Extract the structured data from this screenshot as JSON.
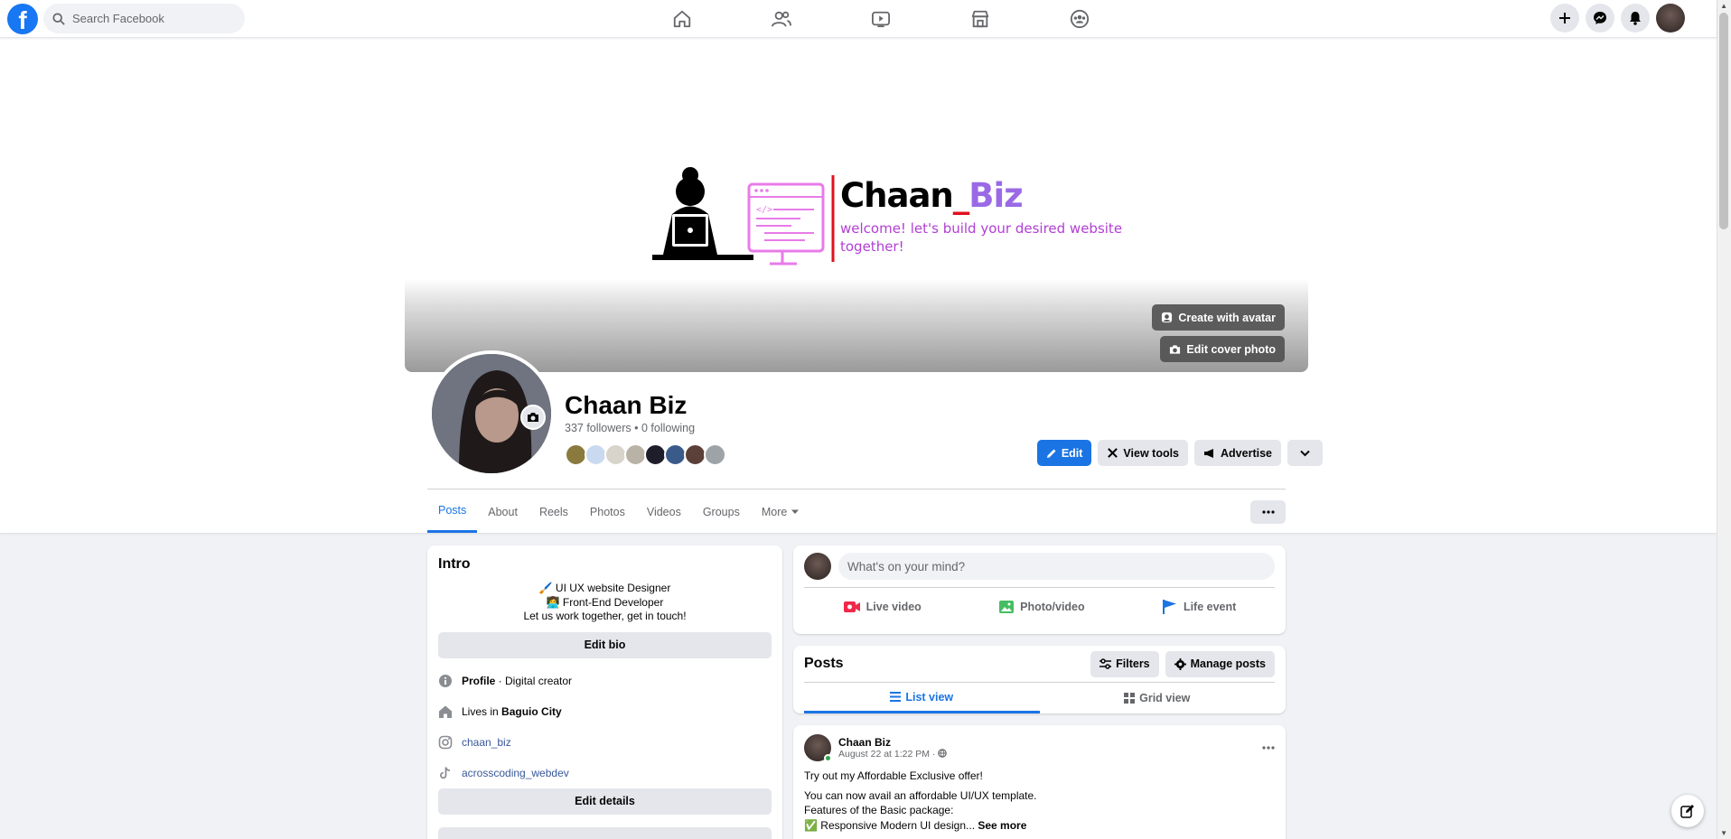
{
  "topbar": {
    "logo": "f",
    "search_placeholder": "Search Facebook",
    "nav": [
      "home-icon",
      "friends-icon",
      "watch-icon",
      "marketplace-icon",
      "groups-icon"
    ]
  },
  "cover": {
    "brand_name": "Chaan",
    "brand_sep": "_",
    "brand_suffix": "Biz",
    "brand_tagline": "welcome! let's build your desired website together!",
    "create_avatar_label": "Create with avatar",
    "edit_cover_label": "Edit cover photo",
    "colors": {
      "brand_black": "#000000",
      "brand_red": "#e0101d",
      "brand_purple": "#9a6ae6",
      "tagline": "#b23fd3"
    }
  },
  "profile": {
    "name": "Chaan Biz",
    "stats": "337 followers • 0 following",
    "actions": {
      "edit": "Edit",
      "view_tools": "View tools",
      "advertise": "Advertise"
    }
  },
  "tabs": [
    "Posts",
    "About",
    "Reels",
    "Photos",
    "Videos",
    "Groups",
    "More"
  ],
  "intro": {
    "title": "Intro",
    "bio_lines": [
      "🖌️ UI UX website Designer",
      "👩‍💻 Front-End Developer",
      "Let us work together, get in touch!"
    ],
    "edit_bio": "Edit bio",
    "profile_label": "Profile",
    "profile_sep": " · ",
    "profile_category": "Digital creator",
    "lives_prefix": "Lives in ",
    "lives_city": "Baguio City",
    "instagram": "chaan_biz",
    "tiktok": "acrosscoding_webdev",
    "edit_details": "Edit details"
  },
  "composer": {
    "placeholder": "What's on your mind?",
    "live": "Live video",
    "photo": "Photo/video",
    "life": "Life event"
  },
  "posts_bar": {
    "title": "Posts",
    "filters": "Filters",
    "manage": "Manage posts",
    "list_view": "List view",
    "grid_view": "Grid view"
  },
  "post": {
    "author": "Chaan Biz",
    "time": "August 22 at 1:22 PM · ",
    "line1": "Try out my Affordable Exclusive offer!",
    "line2": "You can now avail an affordable UI/UX template.",
    "line3": "Features of the Basic package:",
    "line4": "✅ Responsive Modern UI design...",
    "see_more": "See more"
  }
}
